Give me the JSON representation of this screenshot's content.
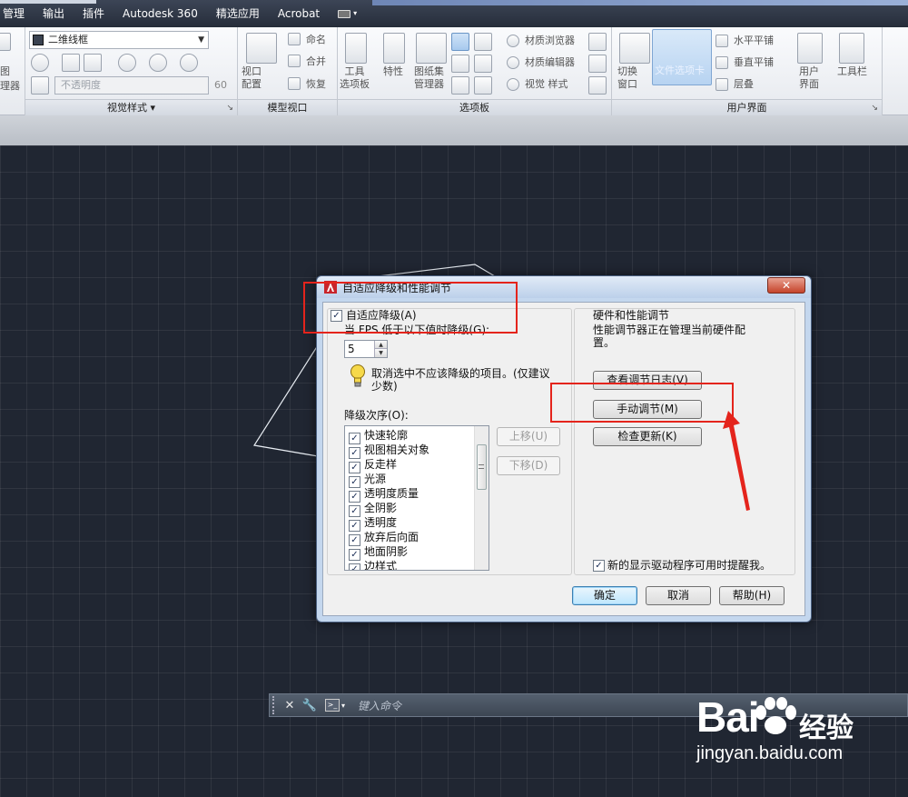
{
  "menubar": {
    "items": [
      "管理",
      "输出",
      "插件",
      "Autodesk 360",
      "精选应用",
      "Acrobat"
    ]
  },
  "ribbon": {
    "visual_styles": {
      "combo_value": "二维线框",
      "opacity_placeholder": "不透明度",
      "opacity_value": "60",
      "panel_title": "视觉样式"
    },
    "model_viewports": {
      "viewport_config": "视口\n配置",
      "named": "命名",
      "join": "合并",
      "restore": "恢复",
      "panel_title": "模型视口"
    },
    "palettes": {
      "tool_palettes": "工具\n选项板",
      "properties": "特性",
      "sheet_set_manager": "图纸集\n管理器",
      "materials_browser": "材质浏览器",
      "materials_editor": "材质编辑器",
      "visual_styles": "视觉 样式",
      "panel_title": "选项板"
    },
    "user_interface": {
      "switch_windows": "切换\n窗口",
      "file_tabs": "文件选项卡",
      "tile_horizontal": "水平平铺",
      "tile_vertical": "垂直平铺",
      "cascade": "层叠",
      "user_interface": "用户\n界面",
      "toolbars": "工具栏",
      "panel_title": "用户界面"
    },
    "left_partial": {
      "label_top": "图",
      "label_bottom": "理器"
    }
  },
  "dialog": {
    "title": "自适应降级和性能调节",
    "close": "✕",
    "adaptive_degradation_label": "自适应降级(A)",
    "adaptive_degradation_checked": true,
    "fps_label": "当 FPS 低于以下值时降级(G):",
    "fps_value": "5",
    "hint": "取消选中不应该降级的项目。(仅建议少数)",
    "hint_line1": "取消选中不应该降级的项目。(仅建议",
    "hint_line2": "少数)",
    "order_label": "降级次序(O):",
    "order_items": [
      {
        "label": "快速轮廓",
        "checked": true
      },
      {
        "label": "视图相关对象",
        "checked": true
      },
      {
        "label": "反走样",
        "checked": true
      },
      {
        "label": "光源",
        "checked": true
      },
      {
        "label": "透明度质量",
        "checked": true
      },
      {
        "label": "全阴影",
        "checked": true
      },
      {
        "label": "透明度",
        "checked": true
      },
      {
        "label": "放弃后向面",
        "checked": true
      },
      {
        "label": "地面阴影",
        "checked": true
      },
      {
        "label": "边样式",
        "checked": true
      }
    ],
    "move_up": "上移(U)",
    "move_down": "下移(D)",
    "hw_title": "硬件和性能调节",
    "hw_desc_line1": "性能调节器正在管理当前硬件配",
    "hw_desc_line2": "置。",
    "view_log": "查看调节日志(V)",
    "manual_tune": "手动调节(M)",
    "check_updates": "检查更新(K)",
    "notify_label": "新的显示驱动程序可用时提醒我。",
    "notify_checked": true,
    "ok": "确定",
    "cancel": "取消",
    "help": "帮助(H)"
  },
  "command_line": {
    "close": "✕",
    "placeholder": "键入命令"
  },
  "watermark": {
    "brand": "Bai",
    "brand_jy": "经验",
    "url": "jingyan.baidu.com"
  },
  "colors": {
    "canvas": "#202632",
    "annotation_red": "#e4241c",
    "dialog_frame": "#c4d7ee",
    "default_button": "#bee6fd"
  }
}
